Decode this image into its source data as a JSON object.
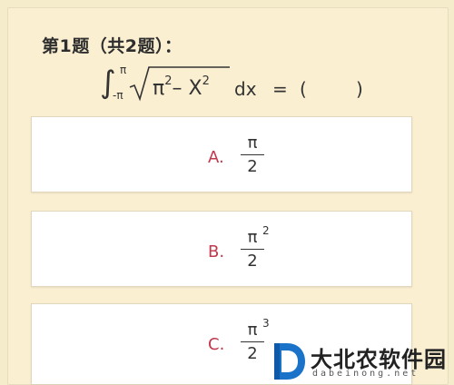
{
  "quiz": {
    "title": "第1题（共2题）：",
    "question": {
      "upper_limit": "π",
      "lower_limit": "-π",
      "radicand_base1": "π",
      "radicand_exp1": "2",
      "radicand_minus": "–",
      "radicand_base2": "X",
      "radicand_exp2": "2",
      "differential": "dx",
      "equals": "=",
      "paren_open": "(",
      "paren_close": ")"
    },
    "options": [
      {
        "letter": "A.",
        "numerator": "π",
        "exponent": "",
        "denominator": "2"
      },
      {
        "letter": "B.",
        "numerator": "π",
        "exponent": "2",
        "denominator": "2"
      },
      {
        "letter": "C.",
        "numerator": "π",
        "exponent": "3",
        "denominator": "2"
      }
    ]
  },
  "watermark": {
    "brand": "大北农软件园",
    "domain": "dabeinong.net",
    "logo_icon": "d-logo-icon",
    "accent_color": "#1a73c8"
  }
}
